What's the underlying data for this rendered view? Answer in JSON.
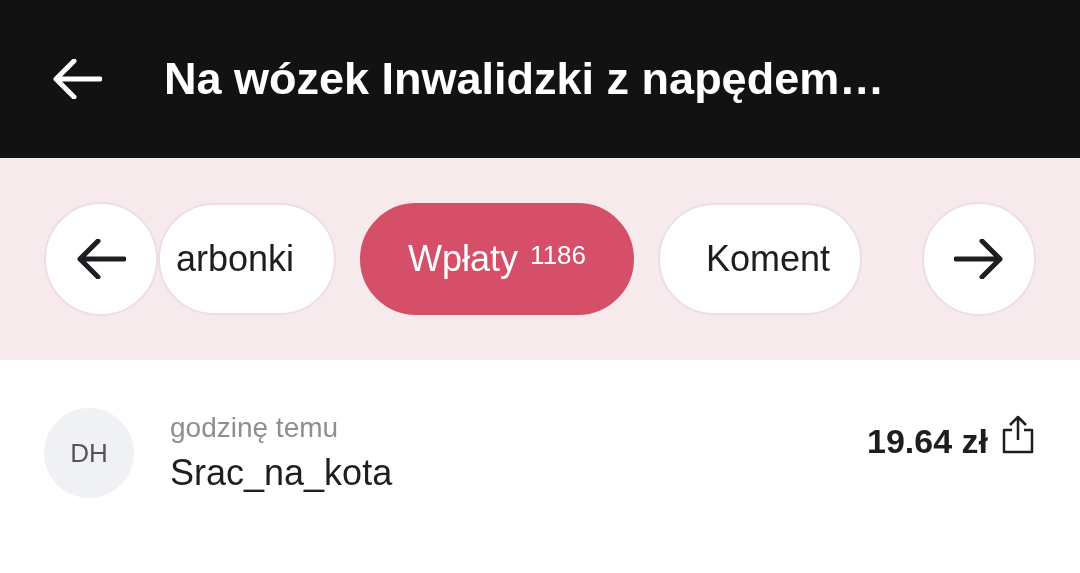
{
  "header": {
    "title": "Na wózek Inwalidzki z napędem…"
  },
  "tabs": [
    {
      "label": "arbonki",
      "selected": false
    },
    {
      "label": "Wpłaty",
      "count": "1186",
      "selected": true
    },
    {
      "label": "Koment",
      "selected": false
    }
  ],
  "donations": [
    {
      "initials": "DH",
      "time": "godzinę temu",
      "name": "Srac_na_kota",
      "amount": "19.64 zł"
    }
  ]
}
